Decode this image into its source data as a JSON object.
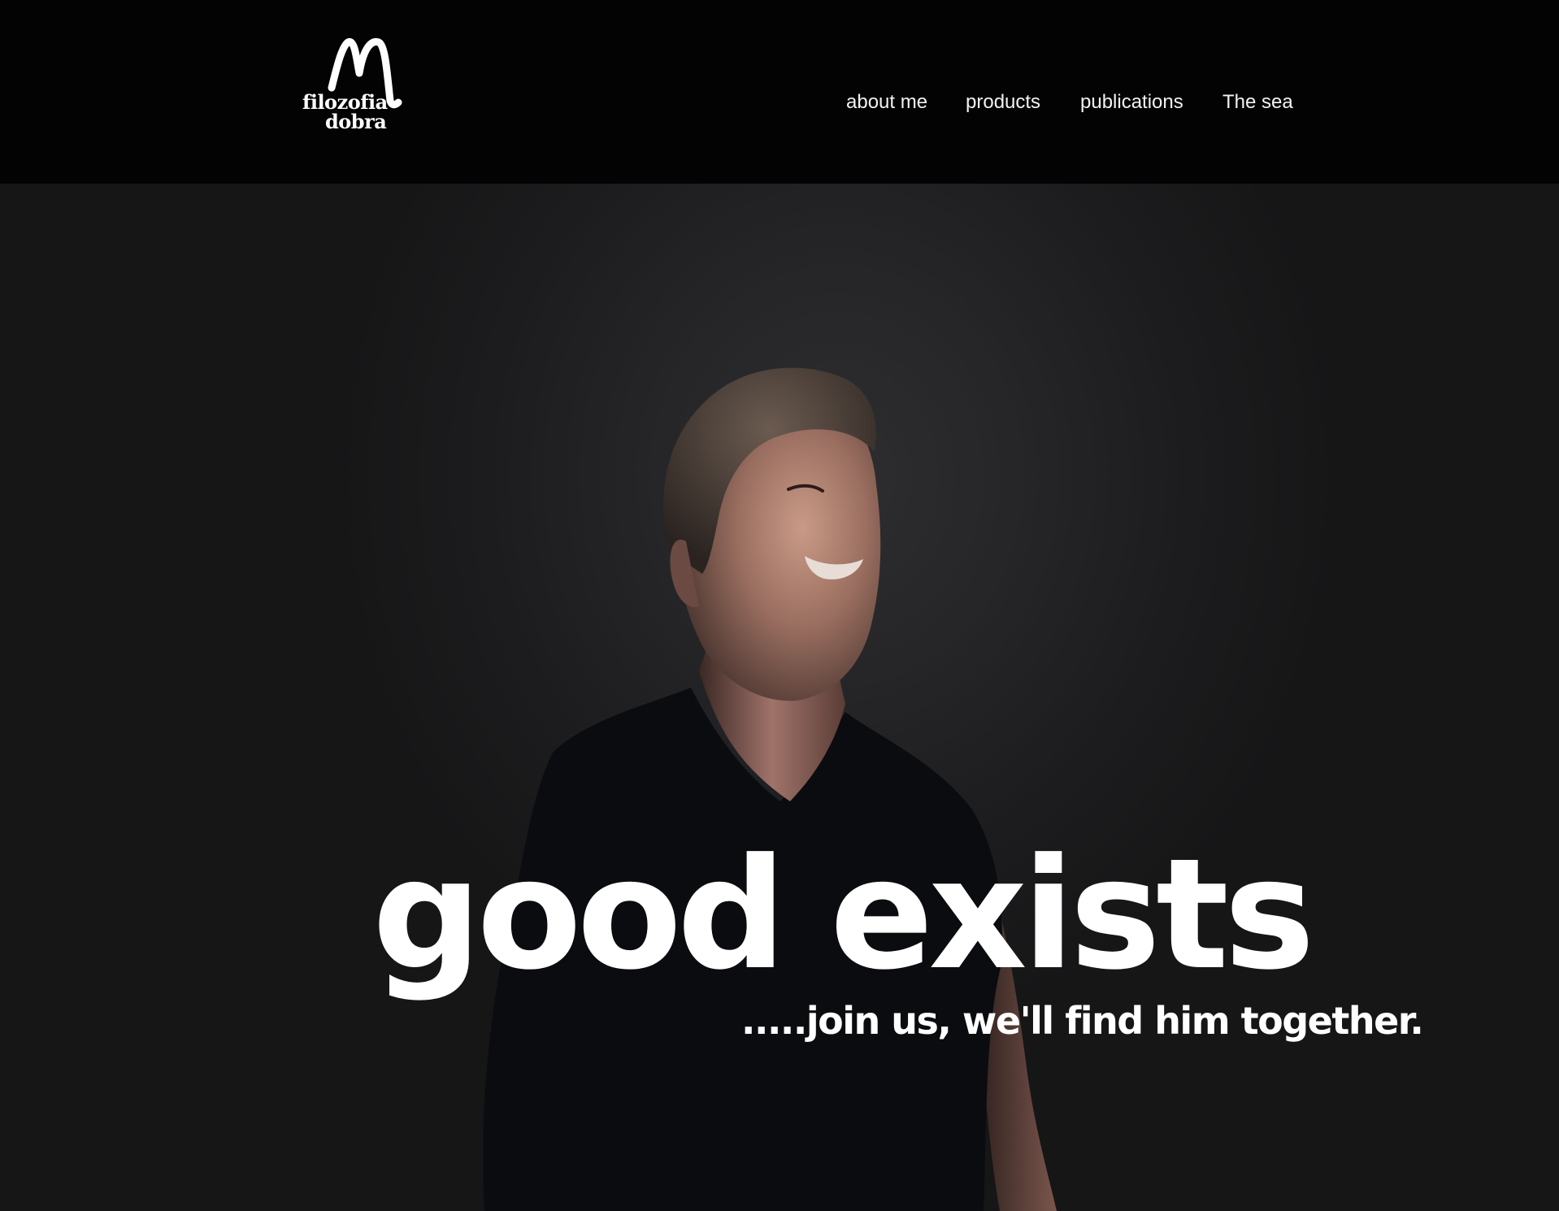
{
  "brand": {
    "logo_text_line1": "filozofia",
    "logo_text_line2": "dobra"
  },
  "nav": {
    "items": [
      {
        "label": "about me"
      },
      {
        "label": "products"
      },
      {
        "label": "publications"
      },
      {
        "label": "The sea"
      }
    ]
  },
  "hero": {
    "headline": "good exists",
    "tagline": ".....join us, we'll find him together.",
    "image": "portrait-photo"
  },
  "colors": {
    "header_bg": "#030303",
    "hero_bg": "#1e1e20",
    "text": "#ffffff"
  }
}
